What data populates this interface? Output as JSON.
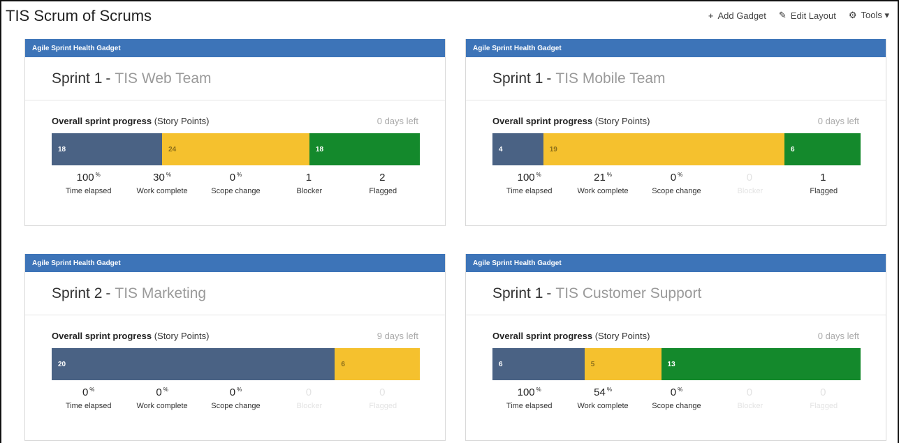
{
  "dashboard": {
    "title": "TIS Scrum of Scrums",
    "toolbar": [
      {
        "icon": "plus-icon",
        "glyph": "+",
        "label": "Add Gadget"
      },
      {
        "icon": "pencil-icon",
        "glyph": "✎",
        "label": "Edit Layout"
      },
      {
        "icon": "gear-icon",
        "glyph": "⚙",
        "label": "Tools ▾"
      }
    ]
  },
  "colors": {
    "header_blue": "#3d74b8",
    "todo": "#4a6284",
    "in_progress": "#f5c12e",
    "done": "#14892c"
  },
  "gadgets": [
    {
      "header": "Agile Sprint Health Gadget",
      "sprint": "Sprint 1",
      "separator": "-",
      "team": "TIS Web Team",
      "progress_label": "Overall sprint progress",
      "progress_unit": "(Story Points)",
      "days_left": "0 days left",
      "segments": [
        {
          "type": "todo",
          "value": 18
        },
        {
          "type": "prog",
          "value": 24
        },
        {
          "type": "done",
          "value": 18
        }
      ],
      "stats": [
        {
          "value": "100",
          "pct": "%",
          "label": "Time elapsed",
          "muted": false
        },
        {
          "value": "30",
          "pct": "%",
          "label": "Work complete",
          "muted": false
        },
        {
          "value": "0",
          "pct": "%",
          "label": "Scope change",
          "muted": false
        },
        {
          "value": "1",
          "pct": "",
          "label": "Blocker",
          "muted": false
        },
        {
          "value": "2",
          "pct": "",
          "label": "Flagged",
          "muted": false
        }
      ]
    },
    {
      "header": "Agile Sprint Health Gadget",
      "sprint": "Sprint 1",
      "separator": "-",
      "team": "TIS Mobile Team",
      "progress_label": "Overall sprint progress",
      "progress_unit": "(Story Points)",
      "days_left": "0 days left",
      "segments": [
        {
          "type": "todo",
          "value": 4
        },
        {
          "type": "prog",
          "value": 19
        },
        {
          "type": "done",
          "value": 6
        }
      ],
      "stats": [
        {
          "value": "100",
          "pct": "%",
          "label": "Time elapsed",
          "muted": false
        },
        {
          "value": "21",
          "pct": "%",
          "label": "Work complete",
          "muted": false
        },
        {
          "value": "0",
          "pct": "%",
          "label": "Scope change",
          "muted": false
        },
        {
          "value": "0",
          "pct": "",
          "label": "Blocker",
          "muted": true
        },
        {
          "value": "1",
          "pct": "",
          "label": "Flagged",
          "muted": false
        }
      ]
    },
    {
      "header": "Agile Sprint Health Gadget",
      "sprint": "Sprint 2",
      "separator": "-",
      "team": "TIS Marketing",
      "progress_label": "Overall sprint progress",
      "progress_unit": "(Story Points)",
      "days_left": "9 days left",
      "segments": [
        {
          "type": "todo",
          "value": 20
        },
        {
          "type": "prog",
          "value": 6
        }
      ],
      "stats": [
        {
          "value": "0",
          "pct": "%",
          "label": "Time elapsed",
          "muted": false
        },
        {
          "value": "0",
          "pct": "%",
          "label": "Work complete",
          "muted": false
        },
        {
          "value": "0",
          "pct": "%",
          "label": "Scope change",
          "muted": false
        },
        {
          "value": "0",
          "pct": "",
          "label": "Blocker",
          "muted": true
        },
        {
          "value": "0",
          "pct": "",
          "label": "Flagged",
          "muted": true
        }
      ]
    },
    {
      "header": "Agile Sprint Health Gadget",
      "sprint": "Sprint 1",
      "separator": "-",
      "team": "TIS Customer Support",
      "progress_label": "Overall sprint progress",
      "progress_unit": "(Story Points)",
      "days_left": "0 days left",
      "segments": [
        {
          "type": "todo",
          "value": 6
        },
        {
          "type": "prog",
          "value": 5
        },
        {
          "type": "done",
          "value": 13
        }
      ],
      "stats": [
        {
          "value": "100",
          "pct": "%",
          "label": "Time elapsed",
          "muted": false
        },
        {
          "value": "54",
          "pct": "%",
          "label": "Work complete",
          "muted": false
        },
        {
          "value": "0",
          "pct": "%",
          "label": "Scope change",
          "muted": false
        },
        {
          "value": "0",
          "pct": "",
          "label": "Blocker",
          "muted": true
        },
        {
          "value": "0",
          "pct": "",
          "label": "Flagged",
          "muted": true
        }
      ]
    }
  ]
}
